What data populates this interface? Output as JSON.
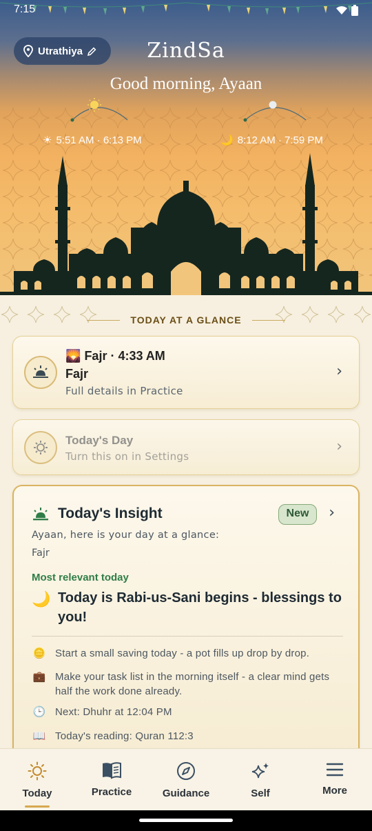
{
  "status": {
    "time": "7:15"
  },
  "header": {
    "location": "Utrathiya",
    "app_title": "ZindSa",
    "greeting": "Good morning, Ayaan",
    "sun_times": "5:51 AM · 6:13 PM",
    "moon_times": "8:12 AM · 7:59 PM"
  },
  "glance": {
    "title": "TODAY AT A GLANCE"
  },
  "fajr_card": {
    "emoji": "🌄",
    "heading": "Fajr · 4:33 AM",
    "name": "Fajr",
    "subtitle": "Full details in Practice"
  },
  "day_card": {
    "title": "Today's Day",
    "subtitle": "Turn this on in Settings"
  },
  "insight": {
    "title": "Today's Insight",
    "badge": "New",
    "greeting": "Ayaan, here is your day at a glance:",
    "prayer": "Fajr",
    "relevant_label": "Most relevant today",
    "headline_icon": "🌙",
    "headline": "Today is Rabi-us-Sani begins - blessings to you!",
    "tips": [
      {
        "icon": "🪙",
        "text": "Start a small saving today - a pot fills up drop by drop."
      },
      {
        "icon": "💼",
        "text": "Make your task list in the morning itself - a clear mind gets half the work done already."
      },
      {
        "icon": "🕒",
        "text": "Next: Dhuhr at 12:04 PM"
      },
      {
        "icon": "📖",
        "text": "Today's reading: Quran 112:3"
      }
    ]
  },
  "nav": {
    "items": [
      {
        "label": "Today",
        "icon": "sun-icon"
      },
      {
        "label": "Practice",
        "icon": "book-icon"
      },
      {
        "label": "Guidance",
        "icon": "compass-icon"
      },
      {
        "label": "Self",
        "icon": "sparkles-icon"
      },
      {
        "label": "More",
        "icon": "menu-icon"
      }
    ],
    "active": "Today"
  },
  "colors": {
    "accent_gold": "#d9b461",
    "relevant_green": "#2f7d47",
    "sky_top": "#3a5c8c",
    "sky_bottom": "#f1c57c",
    "silhouette": "#15261f"
  }
}
